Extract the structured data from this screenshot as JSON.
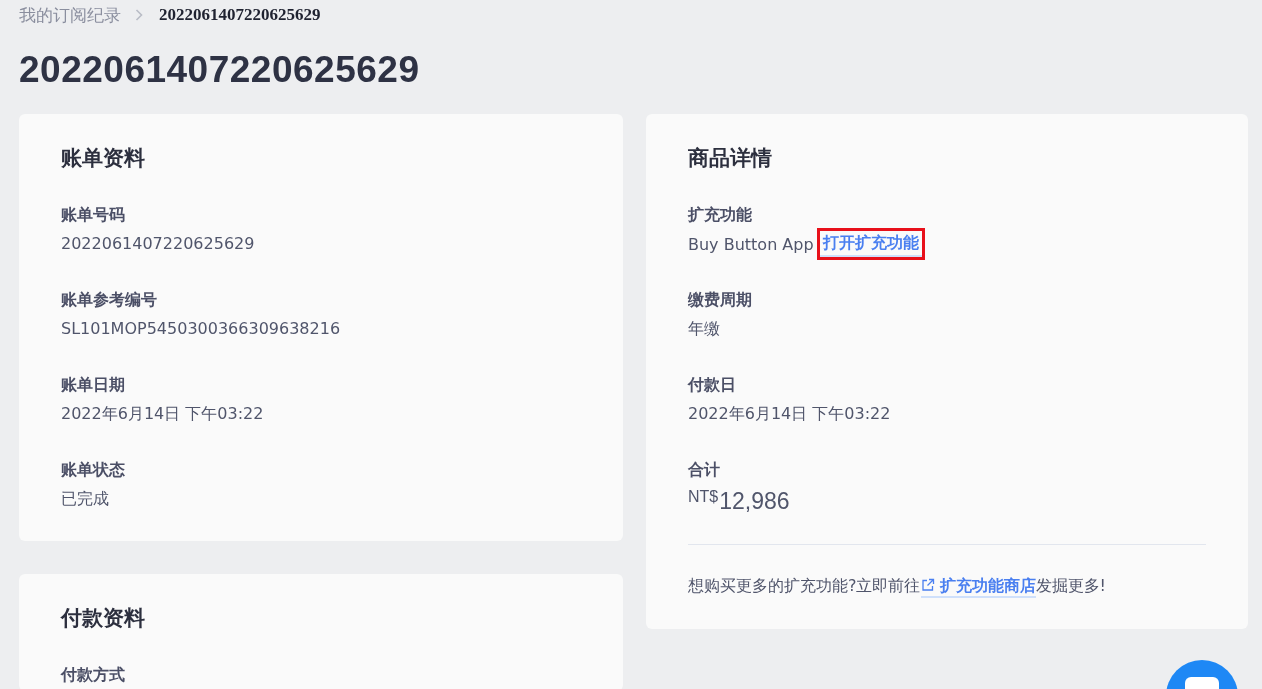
{
  "breadcrumb": [
    {
      "label": "我的订阅纪录",
      "kind": "link"
    },
    {
      "label": "2022061407220625629",
      "kind": "current"
    }
  ],
  "title": "2022061407220625629",
  "billing_info": {
    "heading": "账单资料",
    "fields": [
      {
        "label": "账单号码",
        "kind": "text",
        "value": "2022061407220625629"
      },
      {
        "label": "账单参考编号",
        "kind": "text",
        "value": "SL101MOP5450300366309638216"
      },
      {
        "label": "账单日期",
        "kind": "text",
        "value": "2022年6月14日 下午03:22"
      },
      {
        "label": "账单状态",
        "kind": "text",
        "value": "已完成"
      }
    ]
  },
  "payment_info": {
    "heading": "付款资料",
    "fields": [
      {
        "label": "付款方式"
      }
    ]
  },
  "product_details": {
    "heading": "商品详情",
    "fields": [
      {
        "label": "扩充功能",
        "kind": "text_link",
        "value": "Buy Button App",
        "link": {
          "text": "打开扩充功能",
          "highlighted": true
        }
      },
      {
        "label": "缴费周期",
        "kind": "text",
        "value": "年缴"
      },
      {
        "label": "付款日",
        "kind": "text",
        "value": "2022年6月14日 下午03:22"
      },
      {
        "label": "合计",
        "kind": "amount",
        "currency": "NT$",
        "value": "12,986"
      }
    ],
    "footer": {
      "before": "想购买更多的扩充功能?立即前往",
      "link": "扩充功能商店",
      "after": "发掘更多!"
    }
  }
}
